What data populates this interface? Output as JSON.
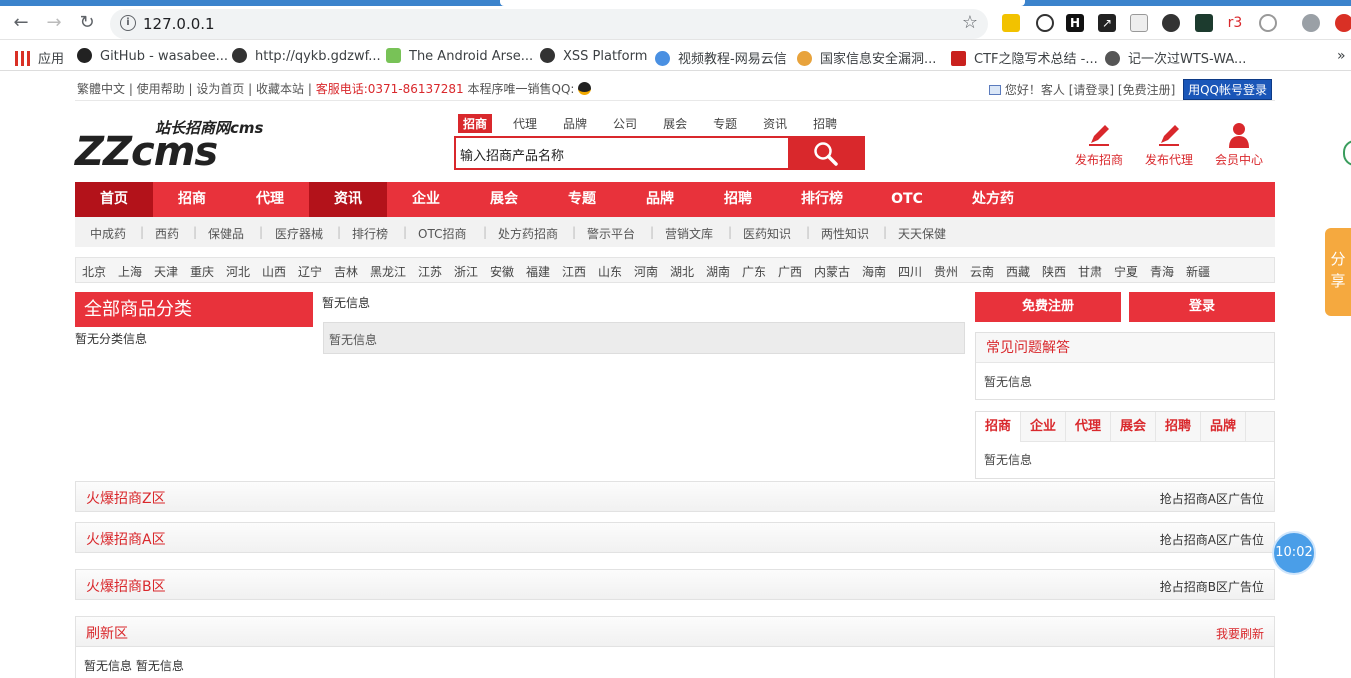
{
  "browser": {
    "url": "127.0.0.1",
    "extensions": [
      "r3"
    ],
    "bookmarks": [
      "应用",
      "GitHub - wasabee...",
      "http://qykb.gdzwf...",
      "The Android Arse...",
      "XSS Platform",
      "视频教程-网易云信",
      "国家信息安全漏洞...",
      "CTF之隐写术总结 -...",
      "记一次过WTS-WA..."
    ]
  },
  "topbar": {
    "links": "繁體中文 | 使用帮助 | 设为首页 | 收藏本站 |",
    "phone": "客服电话:0371-86137281",
    "qq_text": "本程序唯一销售QQ:",
    "greeting": "您好！客人 [请登录] [免费注册]",
    "qq_login": "用QQ帐号登录"
  },
  "logo": {
    "main": "ZZcms",
    "sub": "站长招商网cms"
  },
  "search": {
    "tabs": [
      "招商",
      "代理",
      "品牌",
      "公司",
      "展会",
      "专题",
      "资讯",
      "招聘"
    ],
    "active_tab": "招商",
    "input_value": "输入招商产品名称"
  },
  "actions": [
    "发布招商",
    "发布代理",
    "会员中心"
  ],
  "mainnav": [
    "首页",
    "招商",
    "代理",
    "资讯",
    "企业",
    "展会",
    "专题",
    "品牌",
    "招聘",
    "排行榜",
    "OTC",
    "处方药"
  ],
  "subnav": [
    "中成药",
    "西药",
    "保健品",
    "医疗器械",
    "排行榜",
    "OTC招商",
    "处方药招商",
    "警示平台",
    "营销文库",
    "医药知识",
    "两性知识",
    "天天保健"
  ],
  "regions": [
    "北京",
    "上海",
    "天津",
    "重庆",
    "河北",
    "山西",
    "辽宁",
    "吉林",
    "黑龙江",
    "江苏",
    "浙江",
    "安徽",
    "福建",
    "江西",
    "山东",
    "河南",
    "湖北",
    "湖南",
    "广东",
    "广西",
    "内蒙古",
    "海南",
    "四川",
    "贵州",
    "云南",
    "西藏",
    "陕西",
    "甘肃",
    "宁夏",
    "青海",
    "新疆"
  ],
  "category": {
    "title": "全部商品分类",
    "empty": "暂无分类信息"
  },
  "news": {
    "top": "暂无信息",
    "box": "暂无信息"
  },
  "side": {
    "register": "免费注册",
    "login": "登录",
    "faq_title": "常见问题解答",
    "faq_body": "暂无信息",
    "tabs": [
      "招商",
      "企业",
      "代理",
      "展会",
      "招聘",
      "品牌"
    ],
    "tabs_body": "暂无信息"
  },
  "zones": [
    {
      "title": "火爆招商Z区",
      "ad": "抢占招商A区广告位"
    },
    {
      "title": "火爆招商A区",
      "ad": "抢占招商A区广告位"
    },
    {
      "title": "火爆招商B区",
      "ad": "抢占招商B区广告位"
    },
    {
      "title": "刷新区",
      "ad": "我要刷新"
    }
  ],
  "refresh_body": "暂无信息 暂无信息",
  "floating": {
    "share": "分享",
    "clock": "10:02"
  },
  "colors": {
    "brand_red": "#e8323b",
    "dark_red": "#b3121a",
    "chrome_blue": "#3b83cc"
  }
}
